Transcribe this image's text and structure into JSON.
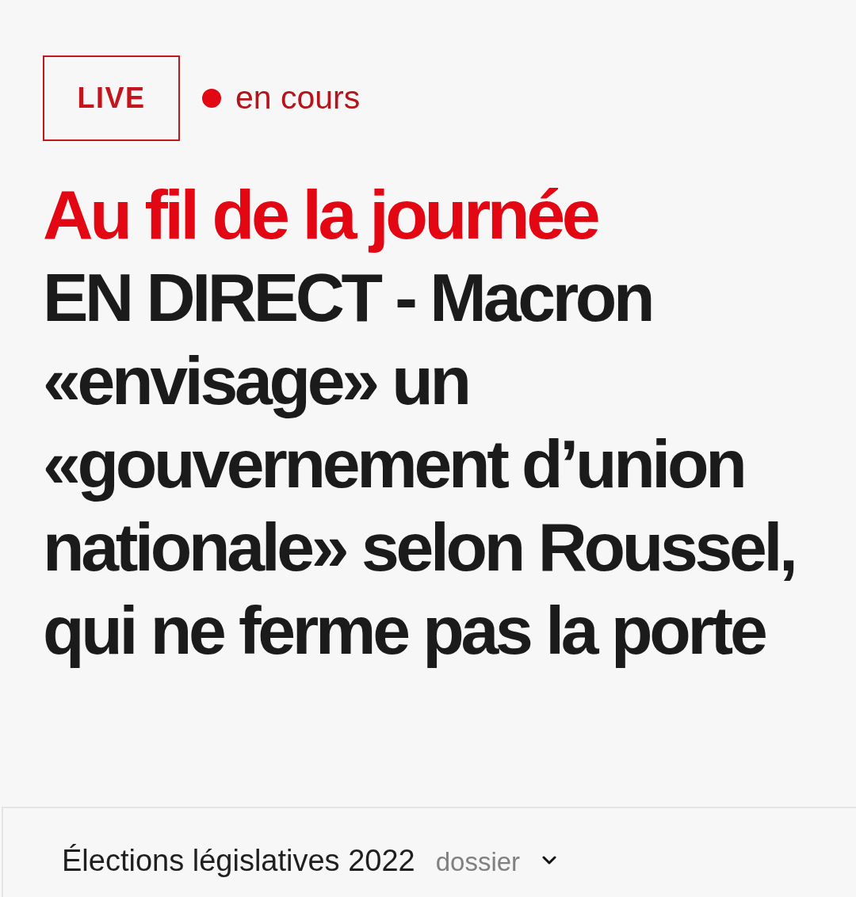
{
  "live_badge": {
    "label": "LIVE"
  },
  "status": {
    "label": "en cours"
  },
  "kicker": "Au fil de la journée",
  "headline": "EN DIRECT - Macron «envisage» un «gouvernement d’union nationale» selon Roussel, qui ne ferme pas la porte",
  "dossier_bar": {
    "title": "Élections législatives 2022",
    "label": "dossier",
    "expanded": false
  }
}
